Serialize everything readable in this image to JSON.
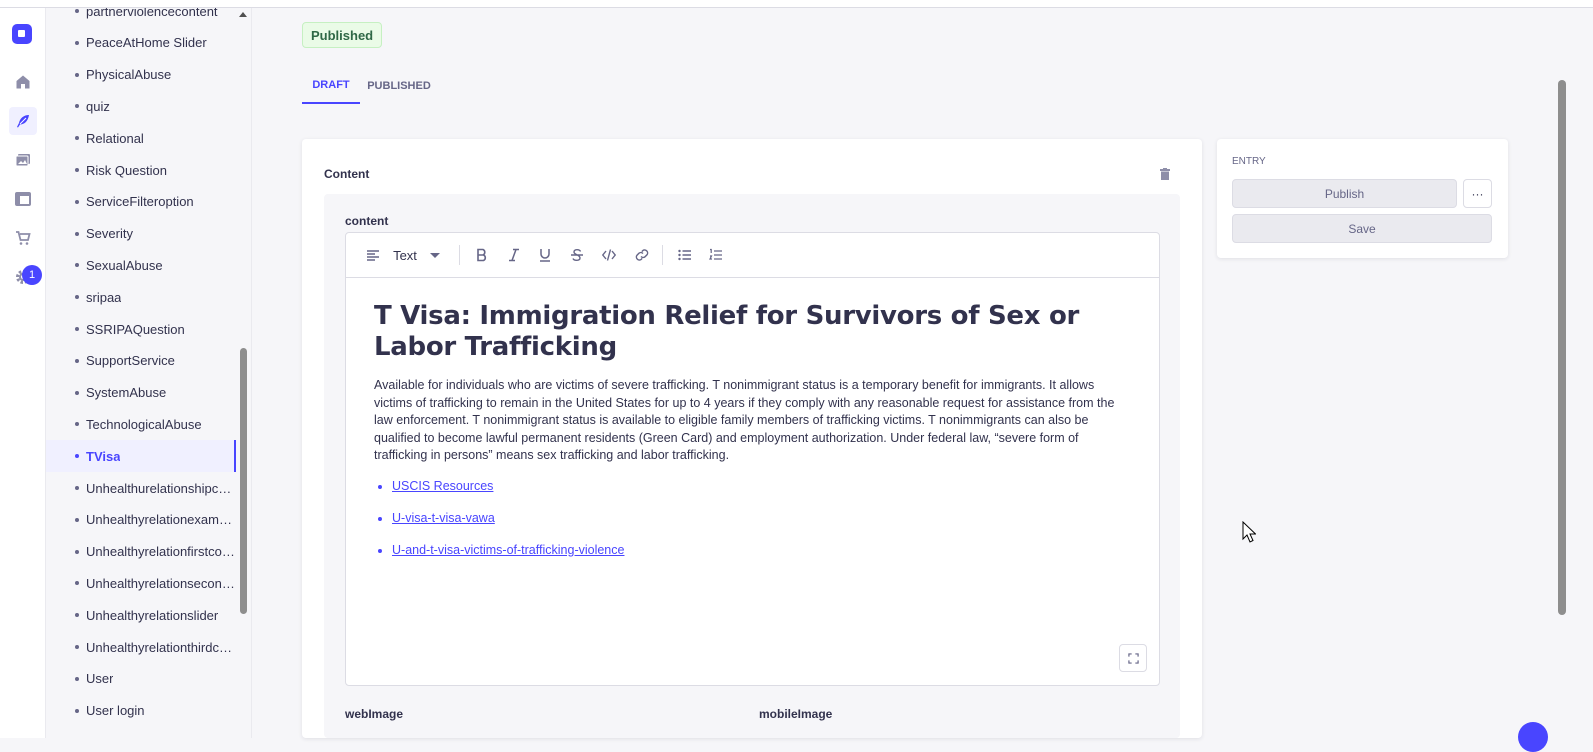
{
  "nav": {
    "notification_count": "1",
    "icons": [
      "home-icon",
      "feather-icon",
      "images-icon",
      "layout-icon",
      "cart-icon",
      "gear-icon"
    ]
  },
  "sidebar": {
    "items": [
      {
        "label": "partnerviolencecontent"
      },
      {
        "label": "PeaceAtHome Slider"
      },
      {
        "label": "PhysicalAbuse"
      },
      {
        "label": "quiz"
      },
      {
        "label": "Relational"
      },
      {
        "label": "Risk Question"
      },
      {
        "label": "ServiceFilteroption"
      },
      {
        "label": "Severity"
      },
      {
        "label": "SexualAbuse"
      },
      {
        "label": "sripaa"
      },
      {
        "label": "SSRIPAQuestion"
      },
      {
        "label": "SupportService"
      },
      {
        "label": "SystemAbuse"
      },
      {
        "label": "TechnologicalAbuse"
      },
      {
        "label": "TVisa"
      },
      {
        "label": "Unhealthurelationshipcon..."
      },
      {
        "label": "Unhealthyrelationexample"
      },
      {
        "label": "Unhealthyrelationfirstcon..."
      },
      {
        "label": "Unhealthyrelationsecond..."
      },
      {
        "label": "Unhealthyrelationslider"
      },
      {
        "label": "Unhealthyrelationthirdco..."
      },
      {
        "label": "User"
      },
      {
        "label": "User login"
      }
    ],
    "active_label": "TVisa"
  },
  "main": {
    "status_badge": "Published",
    "tabs": [
      {
        "label": "DRAFT"
      },
      {
        "label": "PUBLISHED"
      }
    ],
    "content_card": {
      "title": "Content",
      "field_label": "content",
      "toolbar": {
        "block_type": "Text"
      },
      "document": {
        "heading": "T Visa: Immigration Relief for Survivors of Sex or Labor Trafficking",
        "paragraph": "Available for individuals who are victims of severe trafficking. T nonimmigrant status is a  temporary benefit for immigrants. It allows victims of trafficking to remain in the United States  for up to 4 years if they comply with any reasonable request for assistance from the law  enforcement. T nonimmigrant status is available to eligible family members of trafficking  victims. T nonimmigrants can also be qualified to become lawful permanent residents (Green  Card) and employment authorization. Under federal law, “severe form of trafficking in persons”  means sex trafficking and labor trafficking.",
        "links": [
          {
            "text": "USCIS Resources"
          },
          {
            "text": "U-visa-t-visa-vawa"
          },
          {
            "text": "U-and-t-visa-victims-of-trafficking-violence"
          }
        ]
      },
      "web_image_label": "webImage",
      "mobile_image_label": "mobileImage"
    }
  },
  "entry_panel": {
    "title": "ENTRY",
    "publish_label": "Publish",
    "more_label": "···",
    "save_label": "Save"
  },
  "colors": {
    "accent": "#4945ff",
    "success_bg": "#eafbe7",
    "success_text": "#2f6846"
  }
}
